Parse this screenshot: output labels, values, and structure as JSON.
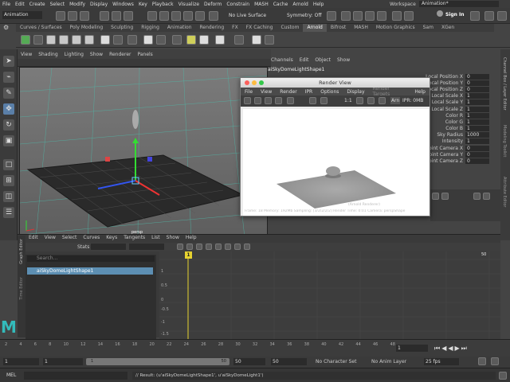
{
  "app": {
    "menu": [
      "File",
      "Edit",
      "Create",
      "Select",
      "Modify",
      "Display",
      "Windows",
      "Key",
      "Playback",
      "Visualize",
      "Deform",
      "Constrain",
      "MASH",
      "Cache",
      "Arnold",
      "Help"
    ],
    "workspace_label": "Workspace",
    "workspace_value": "Animation*"
  },
  "status": {
    "mode": "Animation",
    "live_surface": "No Live Surface",
    "symmetry": "Symmetry: Off",
    "sign_in": "Sign In"
  },
  "shelf": {
    "tabs": [
      "Curves / Surfaces",
      "Poly Modeling",
      "Sculpting",
      "Rigging",
      "Animation",
      "Rendering",
      "FX",
      "FX Caching",
      "Custom",
      "Arnold",
      "Bifrost",
      "MASH",
      "Motion Graphics",
      "Sam",
      "XGen"
    ],
    "active": "Arnold"
  },
  "viewport": {
    "menu": [
      "View",
      "Shading",
      "Lighting",
      "Show",
      "Renderer",
      "Panels"
    ],
    "camera_label": "persp"
  },
  "channel_box": {
    "menu": [
      "Channels",
      "Edit",
      "Object",
      "Show"
    ],
    "node_name": "aiSkyDomeLightShape1",
    "attributes": [
      {
        "label": "Local Position X",
        "value": "0"
      },
      {
        "label": "Local Position Y",
        "value": "0"
      },
      {
        "label": "Local Position Z",
        "value": "0"
      },
      {
        "label": "Local Scale X",
        "value": "1"
      },
      {
        "label": "Local Scale Y",
        "value": "1"
      },
      {
        "label": "Local Scale Z",
        "value": "1"
      },
      {
        "label": "Color R",
        "value": "1"
      },
      {
        "label": "Color G",
        "value": "1"
      },
      {
        "label": "Color B",
        "value": "1"
      },
      {
        "label": "Sky Radius",
        "value": "1000"
      },
      {
        "label": "Intensity",
        "value": "1"
      },
      {
        "label": "Point Camera X",
        "value": "0"
      },
      {
        "label": "Point Camera Y",
        "value": "0"
      },
      {
        "label": "Point Camera Z",
        "value": "0"
      }
    ],
    "side_tabs": [
      "Channel Box / Layer Editor",
      "Modeling Toolkit",
      "Attribute Editor"
    ]
  },
  "render_view": {
    "title": "Render View",
    "menu": [
      "File",
      "View",
      "Render",
      "IPR",
      "Options",
      "Display",
      "Render Targets",
      "Help"
    ],
    "ratio": "1:1",
    "arnold_button": "Arn",
    "ipr_memory": "IPR: 0MB",
    "status_bar": "Frame: 18   Memory: 192Mb   Sampling: [3/2/2/2/2]   Render Time: 0:01   Camera: perspShape",
    "renderer_label": "(Arnold Renderer)"
  },
  "graph_editor": {
    "menu": [
      "Edit",
      "View",
      "Select",
      "Curves",
      "Keys",
      "Tangents",
      "List",
      "Show",
      "Help"
    ],
    "stats_label": "Stats",
    "search_placeholder": "Search...",
    "outliner_item": "aiSkyDomeLightShape1",
    "side_label": "Graph Editor",
    "side_label2": "Time Editor",
    "current_frame": "1",
    "y_ticks": [
      "1",
      "0.5",
      "0",
      "-0.5",
      "-1",
      "-1.5"
    ],
    "x_end": "50"
  },
  "timeline": {
    "ticks": [
      "2",
      "4",
      "6",
      "8",
      "10",
      "12",
      "14",
      "16",
      "18",
      "20",
      "22",
      "24",
      "26",
      "28",
      "30",
      "32",
      "34",
      "36",
      "38",
      "40",
      "42",
      "44",
      "46",
      "48"
    ],
    "current": "1",
    "range_start": "1",
    "range_start2": "1",
    "range_inner_start": "1",
    "range_inner_end": "50",
    "range_end": "50",
    "range_end2": "50",
    "character_set": "No Character Set",
    "anim_layer": "No Anim Layer",
    "fps": "25 fps"
  },
  "command_line": {
    "label": "MEL",
    "result": "// Result: (u'aiSkyDomeLightShape1', u'aiSkyDomeLight1')"
  }
}
